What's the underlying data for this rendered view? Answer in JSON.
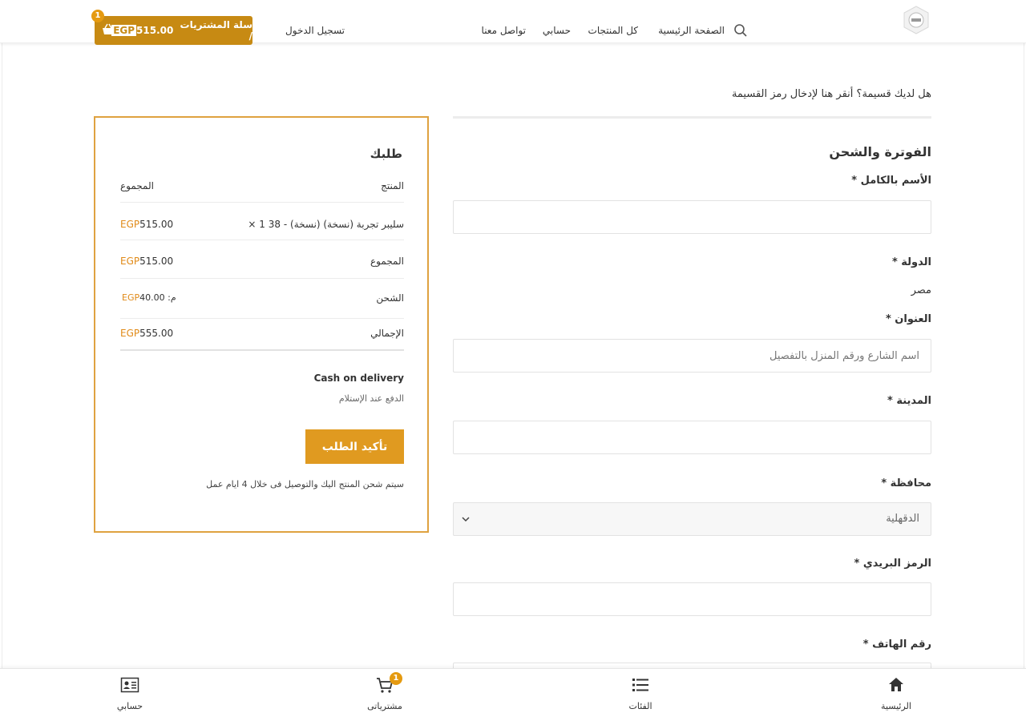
{
  "header": {
    "nav": {
      "home": "الصفحة الرئيسية",
      "all_products": "كل المنتجات",
      "my_account": "حسابي",
      "contact": "تواصل معنا"
    },
    "login": "تسجيل الدخول",
    "cart": {
      "label": "سلة المشتريات /",
      "currency": "EGP",
      "amount": "515.00",
      "count": "1"
    }
  },
  "coupon": {
    "question": "هل لديك قسيمة؟",
    "link": "أنقر هنا لإدخال رمز القسيمة"
  },
  "billing": {
    "title": "الفوترة والشحن",
    "full_name_label": "الأسم بالكامل *",
    "full_name_value": "",
    "country_label": "الدولة *",
    "country_value": "مصر",
    "address_label": "العنوان *",
    "address_placeholder": "اسم الشارع ورقم المنزل بالتفصيل",
    "city_label": "المدينة *",
    "city_value": "",
    "state_label": "محافظة *",
    "state_value": "الدقهلية",
    "postcode_label": "الرمز البريدي *",
    "postcode_value": "",
    "phone_label": "رقم الهاتف *"
  },
  "order": {
    "title": "طلبك",
    "col_product": "المنتج",
    "col_total": "المجموع",
    "item_name": "سليبر تجربة (نسخة) (نسخة) - 38",
    "item_qty": "× 1",
    "item_currency": "EGP",
    "item_total": "515.00",
    "subtotal_label": "المجموع",
    "subtotal_currency": "EGP",
    "subtotal_value": "515.00",
    "shipping_label": "الشحن",
    "shipping_currency": "EGP",
    "shipping_value": "40.00",
    "shipping_suffix": ":م",
    "grand_label": "الإجمالي",
    "grand_currency": "EGP",
    "grand_value": "555.00",
    "payment_method": "Cash on delivery",
    "payment_desc": "الدفع عند الإستلام",
    "confirm_button": "تأكيد الطلب",
    "note": "سيتم شحن المنتج اليك والتوصيل فى خلال 4 ايام عمل"
  },
  "bottom_nav": {
    "home": "الرئيسية",
    "categories": "الفئات",
    "purchases": "مشترياتى",
    "purchases_count": "1",
    "account": "حسابي"
  },
  "colors": {
    "accent": "#c78a13",
    "box_border": "#dfa240",
    "button": "#e09a20",
    "badge": "#e59a10"
  }
}
